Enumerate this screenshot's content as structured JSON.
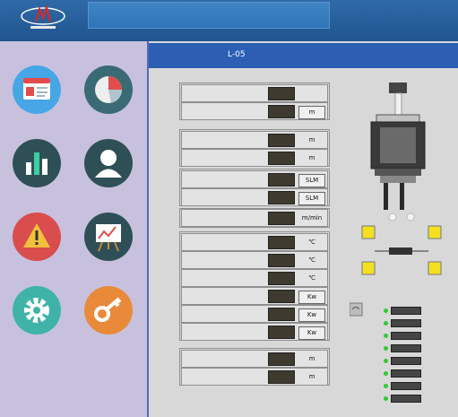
{
  "menu": {
    "tiles": [
      {
        "label": "",
        "color": "#4b2fb7",
        "icon": "browser-window-icon"
      },
      {
        "label": "",
        "color": "#8be38d",
        "icon": "pie-chart-icon"
      },
      {
        "label": "",
        "color": "#5f6ccf",
        "icon": "bar-chart-icon"
      },
      {
        "label": "",
        "color": "#c26b3f",
        "icon": "user-icon"
      },
      {
        "label": "",
        "color": "#8a7ad0",
        "icon": "warning-icon"
      },
      {
        "label": "",
        "color": "#33a24b",
        "icon": "presentation-chart-icon"
      },
      {
        "label": "",
        "color": "#7f7f82",
        "icon": "gear-icon"
      },
      {
        "label": "",
        "color": "#76b81f",
        "icon": "key-icon"
      }
    ]
  },
  "header": {
    "label": "",
    "value": "L-05"
  },
  "groups": [
    {
      "rows": [
        {
          "label": "",
          "value": "",
          "unit": ""
        },
        {
          "label": "",
          "value": "",
          "unit": "m"
        }
      ]
    },
    {
      "rows": [
        {
          "label": "",
          "value": "",
          "unit": "m"
        },
        {
          "label": "",
          "value": "",
          "unit": "m"
        }
      ]
    },
    {
      "rows": [
        {
          "label": "",
          "value": "",
          "unit": "SLM"
        },
        {
          "label": "",
          "value": "",
          "unit": "SLM"
        }
      ]
    },
    {
      "rows": [
        {
          "label": "",
          "value": "",
          "unit": "m/min"
        }
      ]
    },
    {
      "rows": [
        {
          "label": "",
          "value": "",
          "unit": "℃"
        },
        {
          "label": "",
          "value": "",
          "unit": "℃"
        },
        {
          "label": "",
          "value": "",
          "unit": "℃"
        },
        {
          "label": "",
          "value": "",
          "unit": "Kw"
        },
        {
          "label": "",
          "value": "",
          "unit": "Kw"
        },
        {
          "label": "",
          "value": "",
          "unit": "Kw"
        }
      ]
    },
    {
      "rows": [
        {
          "label": "",
          "value": "",
          "unit": "m"
        },
        {
          "label": "",
          "value": "",
          "unit": "m"
        }
      ]
    }
  ],
  "pulleys": [
    "",
    "",
    "",
    ""
  ],
  "indicators": 8,
  "colors": {
    "topbar": "#2068a8",
    "header_strip": "#2c5fb4",
    "value_text": "#f6c14a",
    "led": "#38c638"
  }
}
